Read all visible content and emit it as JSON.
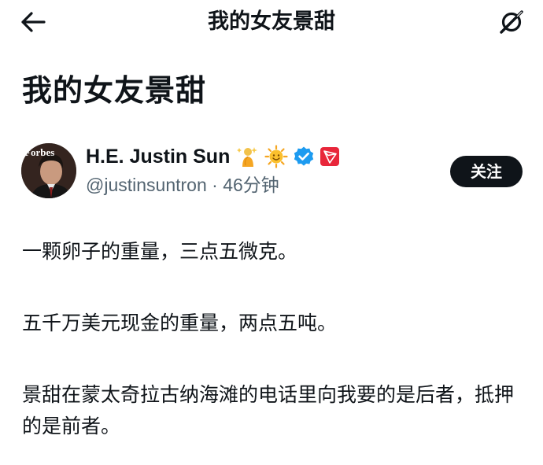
{
  "header": {
    "title": "我的女友景甜",
    "back_icon": "arrow-left-icon",
    "grok_icon": "grok-icon"
  },
  "article": {
    "title": "我的女友景甜"
  },
  "author": {
    "name": "H.E. Justin Sun",
    "handle": "@justinsuntron",
    "separator": "·",
    "time": "46分钟",
    "badges": [
      "genie-emoji",
      "sun-emoji",
      "verified-badge-icon",
      "tron-logo-icon"
    ],
    "follow_label": "关注",
    "avatar_text": "Forbes",
    "verified_color": "#1d9bf0",
    "tron_color": "#e8263a"
  },
  "paragraphs": [
    "一颗卵子的重量，三点五微克。",
    "五千万美元现金的重量，两点五吨。",
    "景甜在蒙太奇拉古纳海滩的电话里向我要的是后者，抵押的是前者。"
  ]
}
